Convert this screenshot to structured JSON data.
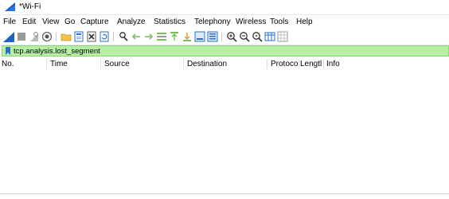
{
  "window": {
    "title": "*Wi-Fi"
  },
  "menu": [
    "File",
    "Edit",
    "View",
    "Go",
    "Capture",
    "Analyze",
    "Statistics",
    "Telephony",
    "Wireless",
    "Tools",
    "Help"
  ],
  "toolbar": {
    "icons": [
      "start-capture-icon",
      "stop-capture-icon",
      "restart-capture-icon",
      "capture-options-icon",
      "open-file-icon",
      "save-file-icon",
      "close-file-icon",
      "reload-file-icon",
      "find-packet-icon",
      "go-back-icon",
      "go-forward-icon",
      "go-to-packet-icon",
      "go-first-icon",
      "go-last-icon",
      "autoscroll-icon",
      "colorize-icon",
      "zoom-in-icon",
      "zoom-out-icon",
      "normal-size-icon",
      "resize-columns-icon",
      "pane-layout-icon"
    ]
  },
  "filter": {
    "value": "tcp.analysis.lost_segment"
  },
  "columns": [
    "No.",
    "Time",
    "Source",
    "Destination",
    "Protocol",
    "Lengtl",
    "Info"
  ],
  "colors": {
    "filter_bg": "#b6f0a5",
    "accent_blue": "#1e5fc8"
  }
}
